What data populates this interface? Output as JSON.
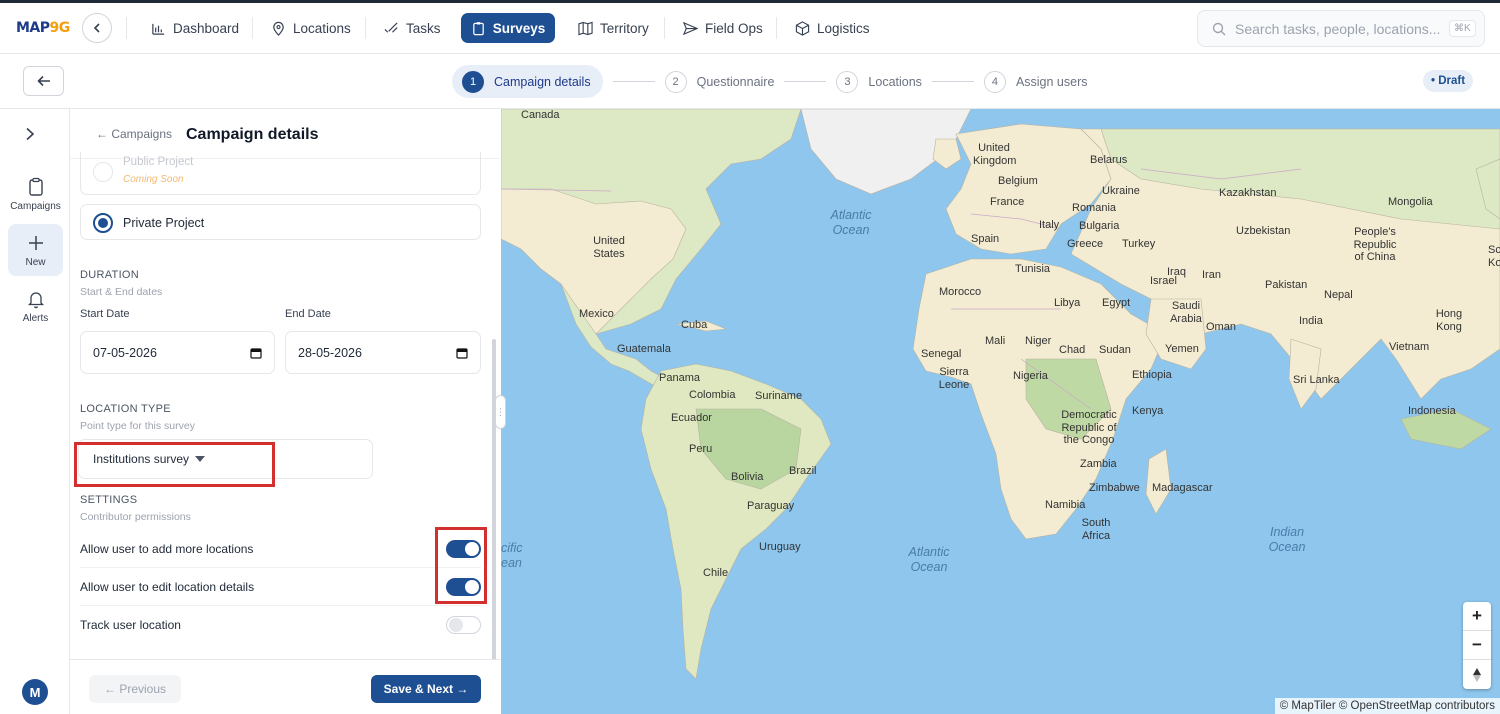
{
  "app": {
    "logo_main": "MAP",
    "logo_accent": "9G"
  },
  "nav": {
    "items": [
      {
        "label": "Dashboard"
      },
      {
        "label": "Locations"
      },
      {
        "label": "Tasks"
      },
      {
        "label": "Surveys"
      },
      {
        "label": "Territory"
      },
      {
        "label": "Field Ops"
      },
      {
        "label": "Logistics"
      }
    ],
    "active": "Surveys",
    "search_placeholder": "Search tasks, people, locations...",
    "search_shortcut": "⌘K"
  },
  "steps": [
    {
      "num": "1",
      "label": "Campaign details"
    },
    {
      "num": "2",
      "label": "Questionnaire"
    },
    {
      "num": "3",
      "label": "Locations"
    },
    {
      "num": "4",
      "label": "Assign users"
    }
  ],
  "status_badge": "• Draft",
  "rail": {
    "items": [
      {
        "label": "Campaigns"
      },
      {
        "label": "New"
      },
      {
        "label": "Alerts"
      }
    ],
    "avatar": "M"
  },
  "panel": {
    "back_link": "← Campaigns",
    "title": "Campaign details",
    "project_options": [
      {
        "label": "Public Project",
        "note": "Coming Soon",
        "selected": false,
        "disabled": true
      },
      {
        "label": "Private Project",
        "selected": true
      }
    ],
    "duration": {
      "heading": "DURATION",
      "sub": "Start & End dates",
      "start_label": "Start Date",
      "start_value": "07-05-2026",
      "end_label": "End Date",
      "end_value": "28-05-2026"
    },
    "location_type": {
      "heading": "LOCATION TYPE",
      "sub": "Point type for this survey",
      "value": "Institutions survey"
    },
    "settings": {
      "heading": "SETTINGS",
      "sub": "Contributor permissions",
      "rows": [
        {
          "label": "Allow user to add more locations",
          "on": true
        },
        {
          "label": "Allow user to edit location details",
          "on": true
        },
        {
          "label": "Track user location",
          "on": false
        }
      ]
    },
    "prev_label": "← Previous",
    "next_label": "Save & Next →"
  },
  "map": {
    "labels": [
      "Canada",
      "United Kingdom",
      "Belarus",
      "Belgium",
      "Ukraine",
      "Kazakhstan",
      "France",
      "Romania",
      "Mongolia",
      "Italy",
      "Bulgaria",
      "Uzbekistan",
      "Spain",
      "Greece",
      "Turkey",
      "People's Republic of China",
      "United States",
      "Tunisia",
      "Iraq",
      "Iran",
      "Israel",
      "Morocco",
      "Libya",
      "Egypt",
      "Saudi Arabia",
      "Pakistan",
      "Nepal",
      "Mexico",
      "Cuba",
      "Oman",
      "India",
      "Hong Kong",
      "Guatemala",
      "Mali",
      "Niger",
      "Senegal",
      "Chad",
      "Sudan",
      "Yemen",
      "Vietnam",
      "Sierra Leone",
      "Nigeria",
      "Ethiopia",
      "Panama",
      "Colombia",
      "Suriname",
      "Sri Lanka",
      "Ecuador",
      "Democratic Republic of the Congo",
      "Kenya",
      "Indonesia",
      "Peru",
      "Brazil",
      "Bolivia",
      "Zambia",
      "Paraguay",
      "Zimbabwe",
      "Madagascar",
      "Namibia",
      "Uruguay",
      "South Africa",
      "Chile",
      "Sc Ko"
    ],
    "oceans": [
      "Atlantic Ocean",
      "Atlantic Ocean",
      "Indian Ocean",
      "cific ean"
    ],
    "attribution": "© MapTiler © OpenStreetMap contributors"
  }
}
